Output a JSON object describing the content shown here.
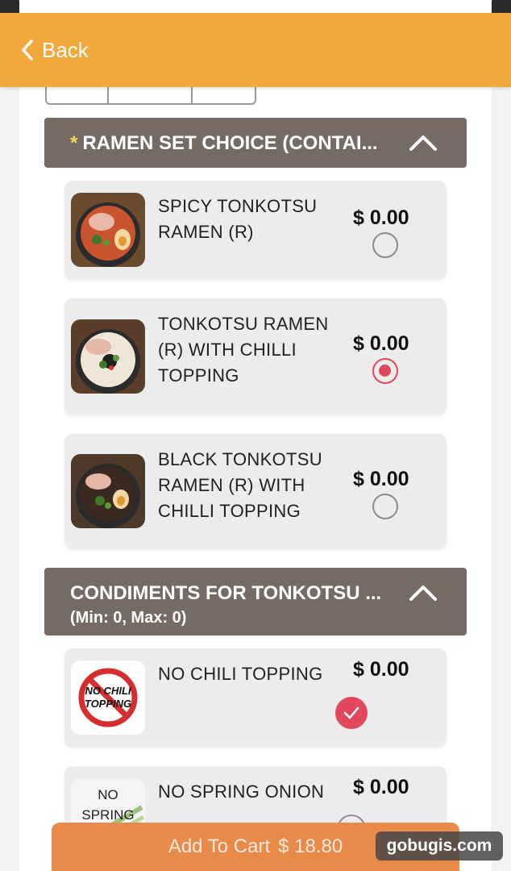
{
  "nav": {
    "back_label": "Back"
  },
  "sections": [
    {
      "required_mark": "*",
      "title": "RAMEN SET CHOICE (CONTAI...",
      "subtitle": "",
      "items": [
        {
          "name_lines": [
            "SPICY TONKOTSU",
            "RAMEN (R)"
          ],
          "price": "$ 0.00",
          "selected": false
        },
        {
          "name_lines": [
            "TONKOTSU RAMEN",
            "(R) WITH CHILLI",
            "TOPPING"
          ],
          "price": "$ 0.00",
          "selected": true
        },
        {
          "name_lines": [
            "BLACK TONKOTSU",
            "RAMEN (R) WITH",
            "CHILLI TOPPING"
          ],
          "price": "$ 0.00",
          "selected": false
        }
      ]
    },
    {
      "required_mark": "",
      "title": "CONDIMENTS FOR TONKOTSU ...",
      "subtitle": "(Min: 0, Max: 0)",
      "items": [
        {
          "name_lines": [
            "NO CHILI TOPPING"
          ],
          "price": "$ 0.00",
          "selected": true,
          "thumb_text": [
            "NO CHILI",
            "TOPPING"
          ]
        },
        {
          "name_lines": [
            "NO SPRING ONION"
          ],
          "price": "$ 0.00",
          "selected": false,
          "thumb_text": [
            "NO",
            "SPRING"
          ]
        }
      ]
    }
  ],
  "cart": {
    "label": "Add To Cart",
    "total": "$ 18.80"
  },
  "watermark": "gobugis.com",
  "colors": {
    "nav": "#f2a93b",
    "section_header": "#766b64",
    "required": "#f3d64e",
    "accent": "#e2485c",
    "cart_button": "#e88a4a"
  },
  "icons": [
    "chevron-left-icon",
    "chevron-up-icon",
    "radio-icon",
    "check-icon"
  ]
}
